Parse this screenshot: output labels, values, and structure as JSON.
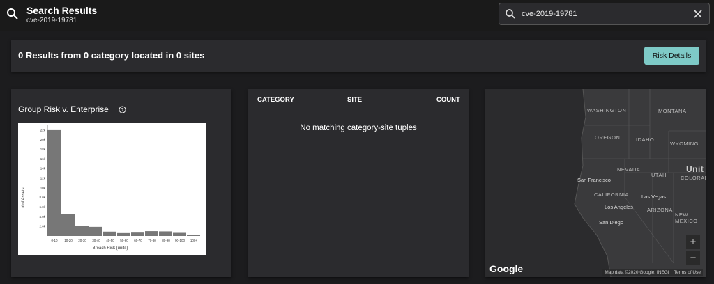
{
  "header": {
    "title": "Search Results",
    "subtitle": "cve-2019-19781"
  },
  "search": {
    "value": "cve-2019-19781"
  },
  "summary": {
    "text": "0 Results from 0 category located in 0 sites",
    "button": "Risk Details"
  },
  "risk_card": {
    "title": "Group Risk v. Enterprise"
  },
  "chart_data": {
    "type": "bar",
    "categories": [
      "0-10",
      "10-20",
      "20-30",
      "30-40",
      "40-50",
      "50-60",
      "60-70",
      "70-80",
      "80-90",
      "90-100",
      "100+"
    ],
    "values": [
      22000,
      4500,
      2100,
      1900,
      900,
      600,
      700,
      1000,
      950,
      650,
      200
    ],
    "xlabel": "Breach Risk (units)",
    "ylabel": "# of Assets",
    "yticks": [
      "2.0k",
      "4.0k",
      "6.0k",
      "8.0k",
      "10k",
      "12k",
      "14k",
      "16k",
      "18k",
      "20k",
      "22k"
    ],
    "ylim": [
      0,
      23000
    ],
    "grid": false,
    "colors": {
      "bar": "#777777"
    }
  },
  "table_card": {
    "columns": [
      "CATEGORY",
      "SITE",
      "COUNT"
    ],
    "empty_text": "No matching category-site tuples"
  },
  "map": {
    "states": [
      "WASHINGTON",
      "MONTANA",
      "OREGON",
      "IDAHO",
      "WYOMING",
      "NEVADA",
      "UTAH",
      "COLORADO",
      "CALIFORNIA",
      "ARIZONA",
      "NEW MEXICO"
    ],
    "cities": [
      "San Francisco",
      "Las Vegas",
      "Los Angeles",
      "San Diego"
    ],
    "country_fragment": "Unit",
    "zoom_in": "+",
    "zoom_out": "−",
    "logo": "Google",
    "attribution": "Map data ©2020 Google, INEGI",
    "terms": "Terms of Use"
  }
}
